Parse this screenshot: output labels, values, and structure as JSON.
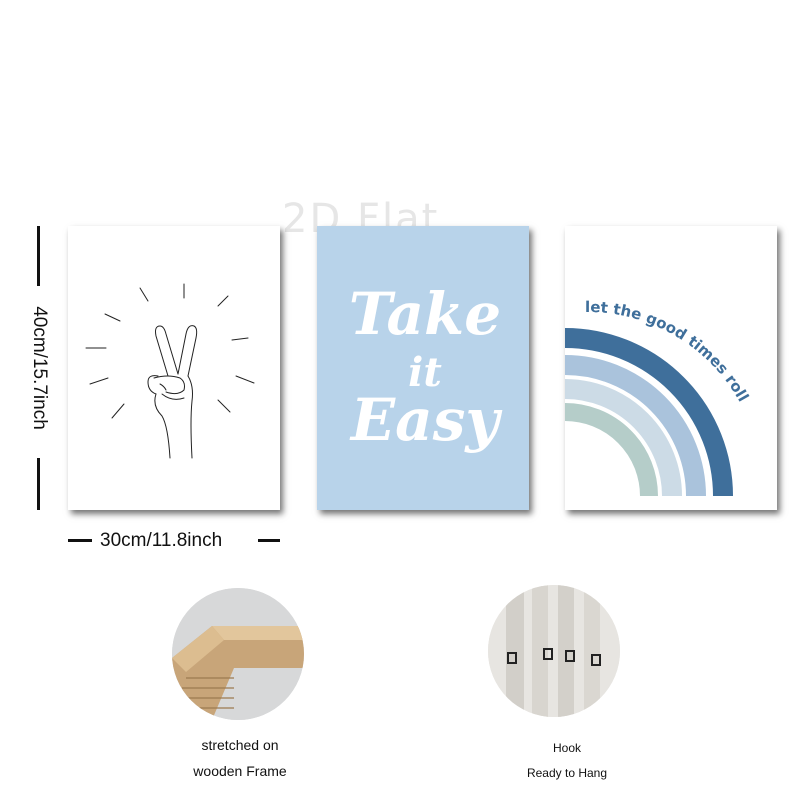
{
  "watermark": "2D Flat",
  "dimensions": {
    "height": "40cm/15.7inch",
    "width": "30cm/11.8inch"
  },
  "canvas2": {
    "line1": "Take",
    "line2": "it",
    "line3": "Easy"
  },
  "canvas3": {
    "text": "let the good times roll"
  },
  "features": [
    {
      "line1": "stretched on",
      "line2": "wooden Frame"
    },
    {
      "line1": "Hook",
      "line2": "Ready to Hang"
    }
  ],
  "colors": {
    "canvas_blue": "#b8d3ea",
    "rainbow_dark": "#3f6f9b",
    "rainbow_mid": "#aac3dc",
    "rainbow_light": "#ccdbe6",
    "rainbow_sage": "#b5cdc9"
  }
}
